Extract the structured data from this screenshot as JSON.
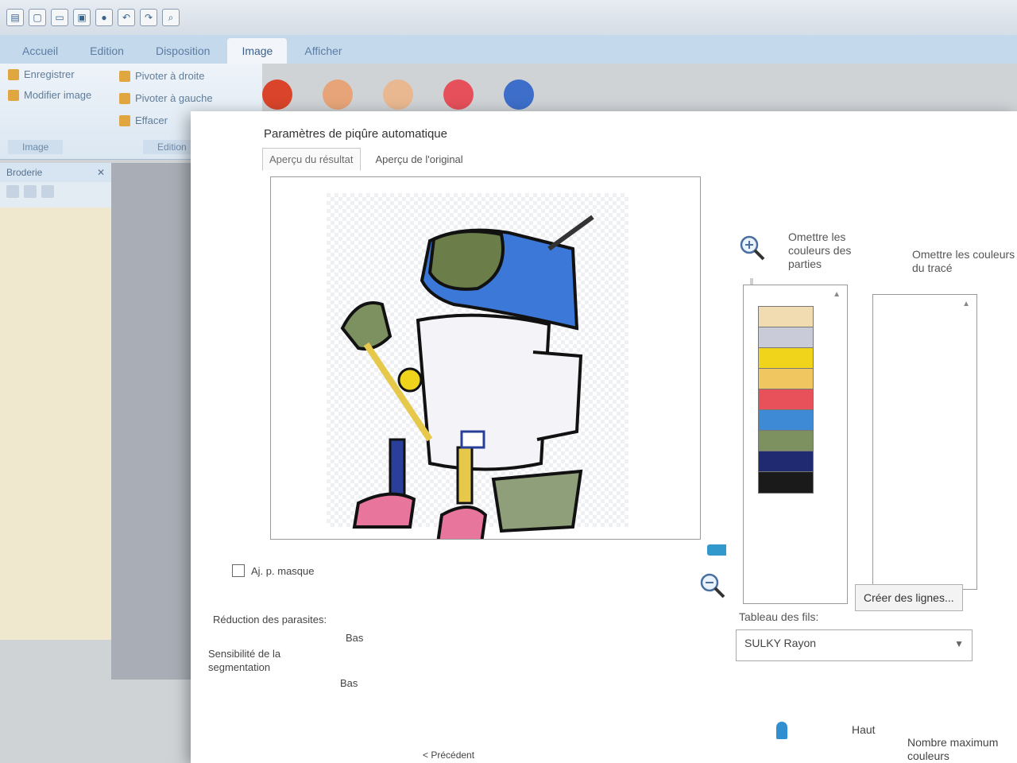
{
  "app": {
    "tabs": [
      "Accueil",
      "Edition",
      "Disposition",
      "Image",
      "Afficher"
    ],
    "active_tab": "Image",
    "ribbon": {
      "items": [
        "Enregistrer",
        "Modifier image",
        "Effacer",
        "Pivoter à droite",
        "Pivoter à gauche"
      ],
      "groups": [
        "Image",
        "Edition"
      ],
      "partial": "auto"
    },
    "side_panel_title": "Broderie",
    "thumbs_colors": [
      "#d9442b",
      "#e7a478",
      "#e9b890",
      "#e5505a",
      "#3d6ec9"
    ]
  },
  "dialog": {
    "title": "Paramètres de piqûre automatique",
    "tabs": [
      "Aperçu du résultat",
      "Aperçu de l'original"
    ],
    "active_tab": "Aperçu du résultat",
    "checkbox_label": "Aj. p. masque",
    "params": [
      {
        "label": "Réduction des parasites:",
        "value": "Bas"
      },
      {
        "label": "Sensibilité de la segmentation",
        "value": "Bas"
      }
    ],
    "parts_label": "Omettre les couleurs des parties",
    "trace_label": "Omettre les couleurs du tracé",
    "parts_colors": [
      "#f0dcb0",
      "#c9ccd8",
      "#f0d41c",
      "#f0c660",
      "#e8505a",
      "#3f8ad4",
      "#7c9060",
      "#1f2a70",
      "#1a1a1a"
    ],
    "create_lines_button": "Créer des lignes...",
    "thread_table_label": "Tableau des fils:",
    "thread_table_value": "SULKY Rayon",
    "bottom_high": "Haut",
    "bottom_max": "Nombre maximum",
    "bottom_max2": "couleurs",
    "bottom_prev": "< Précédent"
  }
}
